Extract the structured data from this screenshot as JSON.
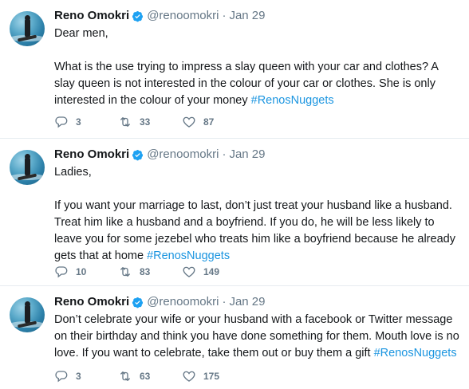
{
  "tweets": [
    {
      "name": "Reno Omokri",
      "handle": "@renoomokri",
      "separator": "·",
      "time": "Jan 29",
      "greeting": "Dear men,",
      "text": "What is the use trying to impress a slay queen with your car and clothes? A slay queen is not interested in the colour of your car or clothes. She is only interested in the colour of your money",
      "hashtag": "#RenosNuggets",
      "replies": "3",
      "retweets": "33",
      "likes": "87"
    },
    {
      "name": "Reno Omokri",
      "handle": "@renoomokri",
      "separator": "·",
      "time": "Jan 29",
      "greeting": "Ladies,",
      "text": "If you want your marriage to last, don’t just treat your husband like a husband. Treat him like a husband and a boyfriend. If you do, he will be less likely to leave you for some jezebel who treats him like a boyfriend because he already gets that at home",
      "hashtag": "#RenosNuggets",
      "replies": "10",
      "retweets": "83",
      "likes": "149"
    },
    {
      "name": "Reno Omokri",
      "handle": "@renoomokri",
      "separator": "·",
      "time": "Jan 29",
      "greeting": "",
      "text": "Don’t celebrate your wife or your husband with a facebook or Twitter message on their birthday and think you have done something for them. Mouth love is no love. If you want to celebrate, take them out or buy them a gift",
      "hashtag": "#RenosNuggets",
      "replies": "3",
      "retweets": "63",
      "likes": "175"
    }
  ],
  "icons": {
    "verified": "verified-badge-icon",
    "reply": "reply-icon",
    "retweet": "retweet-icon",
    "like": "heart-icon"
  },
  "colors": {
    "hashtag": "#1b95e0",
    "verified": "#1da1f2",
    "muted": "#657786",
    "divider": "#e6ecf0"
  }
}
